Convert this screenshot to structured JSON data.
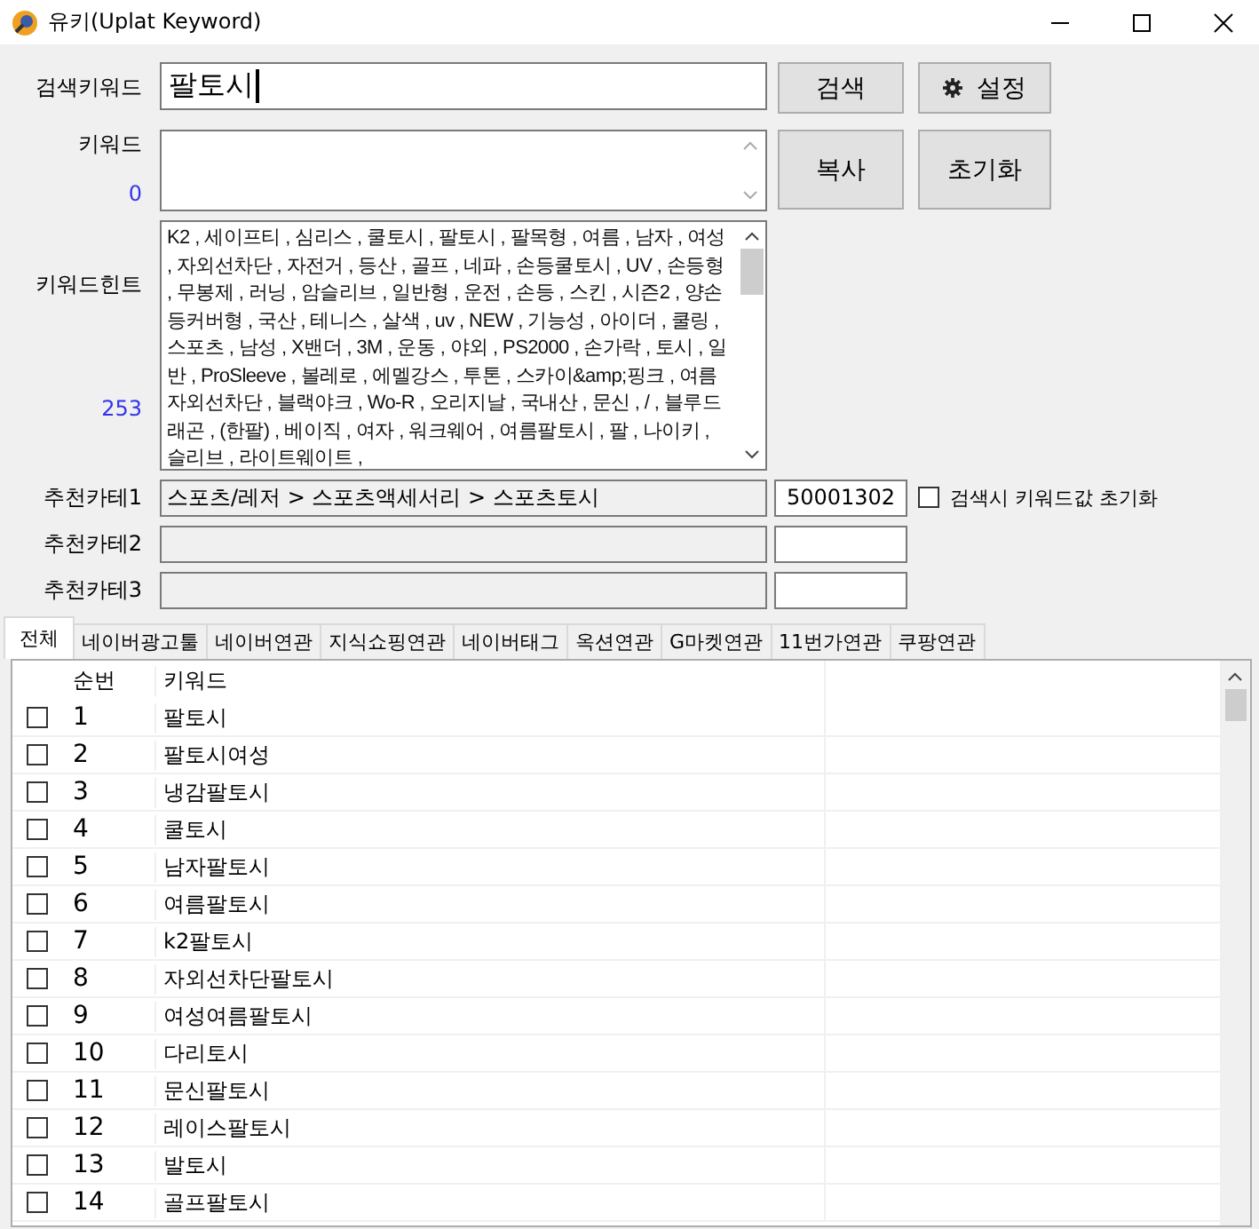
{
  "window": {
    "title": "유키(Uplat Keyword)"
  },
  "search": {
    "label": "검색키워드",
    "value": "팔토시"
  },
  "buttons": {
    "search": "검색",
    "settings": "설정",
    "copy": "복사",
    "reset": "초기화"
  },
  "keyword": {
    "label": "키워드",
    "count": "0"
  },
  "hint": {
    "label": "키워드힌트",
    "count": "253",
    "text": "K2 , 세이프티 , 심리스 , 쿨토시 , 팔토시 , 팔목형 , 여름 , 남자 , 여성 , 자외선차단 , 자전거 , 등산 , 골프 , 네파 , 손등쿨토시 , UV , 손등형 , 무봉제 , 러닝 , 암슬리브 , 일반형 , 운전 , 손등 , 스킨 , 시즌2 , 양손등커버형 , 국산 , 테니스 , 살색 , uv , NEW , 기능성 , 아이더 , 쿨링 , 스포츠 , 남성 , X밴더 , 3M , 운동 , 야외 , PS2000 , 손가락 , 토시 , 일반 , ProSleeve , 볼레로 , 에멜강스 , 투톤 , 스카이&amp;핑크 , 여름자외선차단 , 블랙야크 , Wo-R , 오리지날 , 국내산 , 문신 , / , 블루드래곤 , (한팔) , 베이직 , 여자 , 워크웨어 , 여름팔토시 , 팔 , 나이키 , 슬리브 , 라이트웨이트 ,"
  },
  "categories": [
    {
      "label": "추천카테1",
      "path": "스포츠/레저 > 스포츠액세서리 > 스포츠토시",
      "code": "50001302"
    },
    {
      "label": "추천카테2"
    },
    {
      "label": "추천카테3"
    }
  ],
  "reset_option": {
    "label": "검색시 키워드값 초기화",
    "checked": false
  },
  "tabs": [
    {
      "label": "전체",
      "selected": true
    },
    {
      "label": "네이버광고툴",
      "selected": false
    },
    {
      "label": "네이버연관",
      "selected": false
    },
    {
      "label": "지식쇼핑연관",
      "selected": false
    },
    {
      "label": "네이버태그",
      "selected": false
    },
    {
      "label": "옥션연관",
      "selected": false
    },
    {
      "label": "G마켓연관",
      "selected": false
    },
    {
      "label": "11번가연관",
      "selected": false
    },
    {
      "label": "쿠팡연관",
      "selected": false
    }
  ],
  "table": {
    "columns": [
      "순번",
      "키워드"
    ],
    "rows": [
      {
        "no": "1",
        "keyword": "팔토시",
        "checked": false
      },
      {
        "no": "2",
        "keyword": "팔토시여성",
        "checked": false
      },
      {
        "no": "3",
        "keyword": "냉감팔토시",
        "checked": false
      },
      {
        "no": "4",
        "keyword": "쿨토시",
        "checked": false
      },
      {
        "no": "5",
        "keyword": "남자팔토시",
        "checked": false
      },
      {
        "no": "6",
        "keyword": "여름팔토시",
        "checked": false
      },
      {
        "no": "7",
        "keyword": "k2팔토시",
        "checked": false
      },
      {
        "no": "8",
        "keyword": "자외선차단팔토시",
        "checked": false
      },
      {
        "no": "9",
        "keyword": "여성여름팔토시",
        "checked": false
      },
      {
        "no": "10",
        "keyword": "다리토시",
        "checked": false
      },
      {
        "no": "11",
        "keyword": "문신팔토시",
        "checked": false
      },
      {
        "no": "12",
        "keyword": "레이스팔토시",
        "checked": false
      },
      {
        "no": "13",
        "keyword": "발토시",
        "checked": false
      },
      {
        "no": "14",
        "keyword": "골프팔토시",
        "checked": false
      }
    ]
  }
}
